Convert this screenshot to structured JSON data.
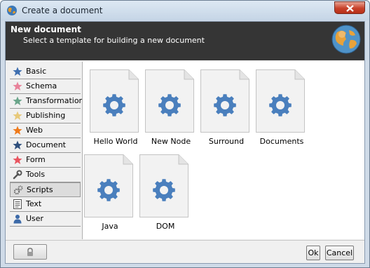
{
  "window": {
    "title": "Create a document",
    "close_icon": "close-icon",
    "app_icon": "globe-icon"
  },
  "header": {
    "title": "New document",
    "subtitle": "Select a template for building a new document",
    "icon": "globe-icon"
  },
  "sidebar": {
    "items": [
      {
        "label": "Basic",
        "icon": "star-icon",
        "color": "#3f6fb0"
      },
      {
        "label": "Schema",
        "icon": "star-icon",
        "color": "#e8829a"
      },
      {
        "label": "Transformation",
        "icon": "star-icon",
        "color": "#6aa58a"
      },
      {
        "label": "Publishing",
        "icon": "star-icon",
        "color": "#e7c97a"
      },
      {
        "label": "Web",
        "icon": "star-icon",
        "color": "#ef7a1a"
      },
      {
        "label": "Document",
        "icon": "star-icon",
        "color": "#2e4f7d"
      },
      {
        "label": "Form",
        "icon": "star-icon",
        "color": "#e95560"
      },
      {
        "label": "Tools",
        "icon": "wrench-icon",
        "color": "#555555"
      },
      {
        "label": "Scripts",
        "icon": "gears-icon",
        "color": "#6a6a6a"
      },
      {
        "label": "Text",
        "icon": "text-doc-icon",
        "color": "#555555"
      },
      {
        "label": "User",
        "icon": "user-icon",
        "color": "#3c6aa8"
      }
    ],
    "selected": "Scripts"
  },
  "templates": [
    {
      "label": "Hello World",
      "icon": "gear-icon"
    },
    {
      "label": "New Node",
      "icon": "gear-icon"
    },
    {
      "label": "Surround",
      "icon": "gear-icon"
    },
    {
      "label": "Documents",
      "icon": "gear-icon"
    },
    {
      "label": "Java",
      "icon": "gear-icon"
    },
    {
      "label": "DOM",
      "icon": "gear-icon"
    }
  ],
  "footer": {
    "lock_icon": "lock-icon",
    "ok_label": "Ok",
    "cancel_label": "Cancel"
  },
  "colors": {
    "header_bg": "#353535",
    "gear": "#4a7fbd",
    "page": "#f2f2f2"
  }
}
